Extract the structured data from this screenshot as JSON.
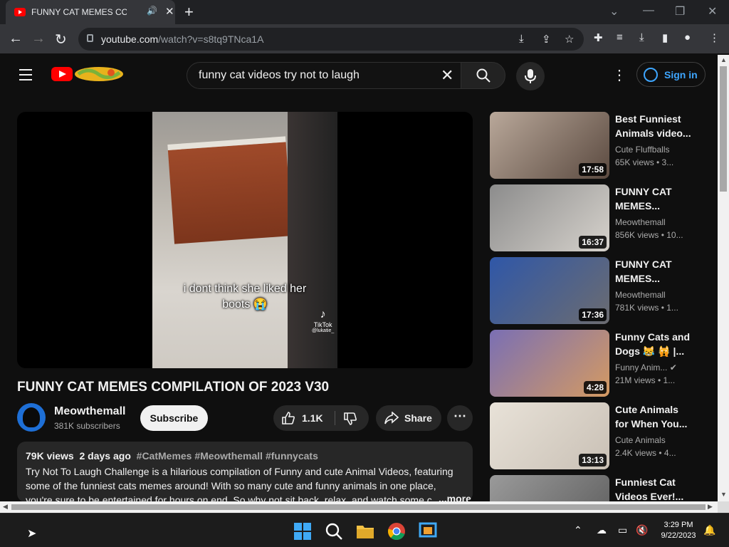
{
  "browser": {
    "tab_title": "FUNNY CAT MEMES COMPIL",
    "url_domain": "youtube.com",
    "url_path": "/watch?v=s8tq9TNca1A"
  },
  "youtube": {
    "search_query": "funny cat videos try not to laugh",
    "sign_in": "Sign in"
  },
  "video": {
    "caption_line1": "i dont think she liked her",
    "caption_line2": "boots 😭",
    "watermark": "TikTok",
    "watermark_handle": "@lukatie_",
    "title": "FUNNY CAT MEMES COMPILATION OF 2023 V30",
    "channel": "Meowthemall",
    "subscribers": "381K subscribers",
    "subscribe_label": "Subscribe",
    "likes": "1.1K",
    "share_label": "Share",
    "views": "79K views",
    "age": "2 days ago",
    "hashtags": "#CatMemes #Meowthemall #funnycats",
    "description": "Try Not To Laugh Challenge is a hilarious compilation of Funny and cute Animal Videos, featuring some of the funniest cats memes around! With so many cute and funny animals in one place, you're sure to be entertained for hours on end. So why not sit back, relax, and watch some c",
    "more_label": "...more"
  },
  "recommendations": [
    {
      "title": "Best Funniest Animals video...",
      "channel": "Cute Fluffballs",
      "stats": "65K views • 3...",
      "duration": "17:58",
      "colors": [
        "#b9a89a",
        "#5b4a40"
      ]
    },
    {
      "title": "FUNNY CAT MEMES...",
      "channel": "Meowthemall",
      "stats": "856K views • 10...",
      "duration": "16:37",
      "colors": [
        "#8c8c8c",
        "#d6d2cc"
      ]
    },
    {
      "title": "FUNNY CAT MEMES...",
      "channel": "Meowthemall",
      "stats": "781K views • 1...",
      "duration": "17:36",
      "colors": [
        "#2f57a8",
        "#6c6c70"
      ]
    },
    {
      "title": "Funny Cats and Dogs 😹 🙀 |...",
      "channel": "Funny Anim...",
      "stats": "21M views • 1...",
      "duration": "4:28",
      "colors": [
        "#7a6fb4",
        "#d49a62"
      ]
    },
    {
      "title": "Cute Animals for When You...",
      "channel": "Cute Animals",
      "stats": "2.4K views • 4...",
      "duration": "13:13",
      "colors": [
        "#e8e2d8",
        "#c9c0b5"
      ]
    },
    {
      "title": "Funniest Cat Videos Ever!...",
      "channel": "",
      "stats": "",
      "duration": "",
      "colors": [
        "#9a9a9a",
        "#5a5a5a"
      ]
    }
  ],
  "taskbar": {
    "time": "3:29 PM",
    "date": "9/22/2023"
  }
}
